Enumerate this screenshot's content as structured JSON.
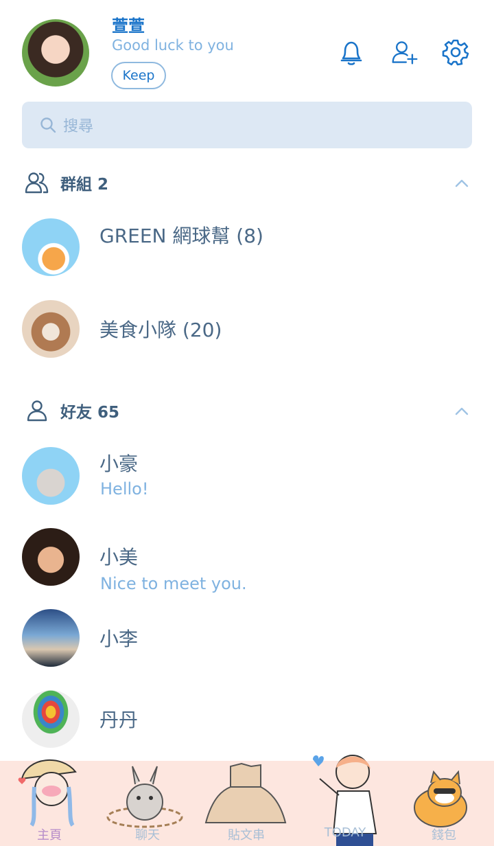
{
  "profile": {
    "name": "萱萱",
    "status": "Good luck to you",
    "keep_label": "Keep"
  },
  "header_icons": [
    "bell-icon",
    "add-friend-icon",
    "settings-gear-icon"
  ],
  "search": {
    "placeholder": "搜尋"
  },
  "groups": {
    "header": "群組 2",
    "items": [
      {
        "name": "GREEN 網球幫 (8)"
      },
      {
        "name": "美食小隊 (20)"
      }
    ]
  },
  "friends": {
    "header": "好友 65",
    "items": [
      {
        "name": "小豪",
        "status": "Hello!"
      },
      {
        "name": "小美",
        "status": "Nice to meet you."
      },
      {
        "name": "小李",
        "status": ""
      },
      {
        "name": "丹丹",
        "status": ""
      }
    ]
  },
  "nav": {
    "tabs": [
      {
        "label": "主頁",
        "active": true
      },
      {
        "label": "聊天"
      },
      {
        "label": "貼文串"
      },
      {
        "label": "TODAY"
      },
      {
        "label": "錢包"
      }
    ]
  },
  "colors": {
    "accent": "#1a74c9",
    "search_bg": "#dde8f4",
    "nav_bg": "#fde6df"
  }
}
